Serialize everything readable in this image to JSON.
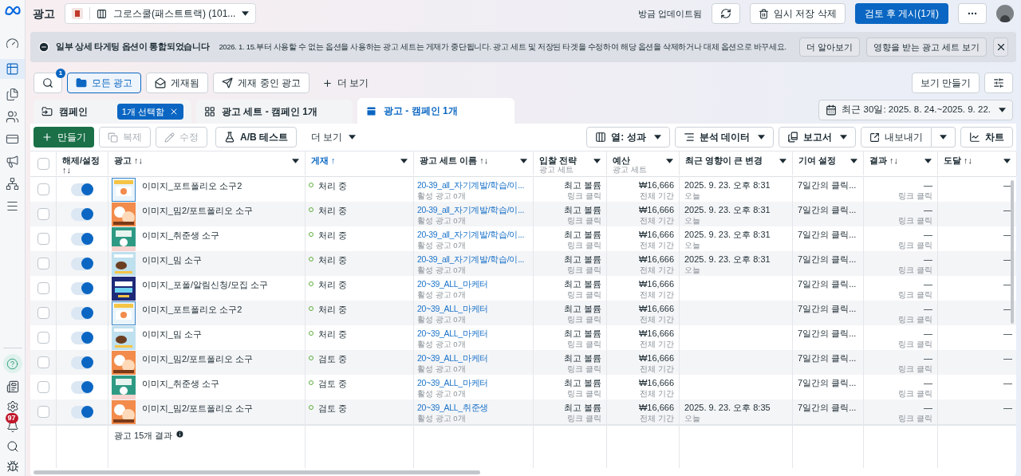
{
  "topbar": {
    "title": "광고",
    "account": "그로스쿨(패스트트랙) (101...",
    "update_status": "방금 업데이트됨",
    "discard": "임시 저장 삭제",
    "publish": "검토 후 게시(1개)"
  },
  "sidebar": {
    "notification_count": "97"
  },
  "banner": {
    "title": "일부 상세 타게팅 옵션이 통합되었습니다",
    "message": "2026. 1. 15.부터 사용할 수 없는 옵션을 사용하는 광고 세트는 게재가 중단됩니다. 광고 세트 및 저장된 타겟을 수정하여 해당 옵션을 삭제하거나 대체 옵션으로 바꾸세요.",
    "buttons": [
      "더 알아보기",
      "영향을 받는 광고 세트 보기"
    ]
  },
  "filters": {
    "search_badge": "1",
    "chips": [
      {
        "label": "모든 광고",
        "selected": true
      },
      {
        "label": "게재됨",
        "selected": false
      },
      {
        "label": "게재 중인 광고",
        "selected": false
      }
    ],
    "more": "더 보기",
    "create_view": "보기 만들기"
  },
  "level_tabs": [
    {
      "label": "캠페인",
      "selected": false,
      "chip": "1개 선택함"
    },
    {
      "label": "광고 세트 - 캠페인 1개",
      "selected": false
    },
    {
      "label": "광고 - 캠페인 1개",
      "selected": true
    }
  ],
  "date_range": "최근 30일: 2025. 8. 24.~2025. 9. 22.",
  "toolbar": {
    "left": [
      {
        "label": "만들기",
        "kind": "primary",
        "disabled": false
      },
      {
        "label": "복제",
        "kind": "duplicate",
        "disabled": true
      },
      {
        "label": "수정",
        "kind": "edit",
        "disabled": true
      },
      {
        "label": "A/B 테스트",
        "kind": "test",
        "disabled": false
      },
      {
        "label": "더 보기",
        "kind": "more",
        "disabled": false
      }
    ],
    "right": [
      {
        "label": "열: 성과",
        "kind": "columns"
      },
      {
        "label": "분석 데이터",
        "kind": "breakdown"
      },
      {
        "label": "보고서",
        "kind": "reports"
      },
      {
        "label": "내보내기",
        "kind": "export"
      },
      {
        "label": "차트",
        "kind": "chart"
      }
    ]
  },
  "table": {
    "all_selected": false,
    "columns": [
      {
        "label": "해제/설정 ↑↓",
        "sorted": false
      },
      {
        "label": "광고 ↑↓",
        "sorted": false
      },
      {
        "label": "게재 ↑",
        "sorted": true
      },
      {
        "label": "광고 세트 이름 ↑↓",
        "sorted": false
      },
      {
        "label": "입찰 전략",
        "sublabel": "광고 세트",
        "sorted": false
      },
      {
        "label": "예산",
        "sublabel": "광고 세트",
        "sorted": false
      },
      {
        "label": "최근 영향이 큰 변경",
        "sorted": false
      },
      {
        "label": "기여 설정",
        "sorted": false
      },
      {
        "label": "결과 ↑↓",
        "sorted": false
      },
      {
        "label": "도달 ↑↓",
        "sorted": false
      }
    ],
    "rows": [
      {
        "selected": false,
        "on": true,
        "name": "이미지_포트폴리오 소구2",
        "status": "처리 중",
        "adset": "20-39_all_자기계발/학습/이...",
        "adset_sub": "활성 광고 0개",
        "bid": "최고 볼륨",
        "bid_sub": "링크 클릭",
        "budget": "₩16,666",
        "budget_sub": "전체 기간",
        "change": "2025. 9. 23. 오후 8:31",
        "change_sub": "오늘",
        "attribution": "7일간의 클릭...",
        "result": "—",
        "result_sub": "링크 클릭",
        "reach": "—"
      },
      {
        "selected": false,
        "on": true,
        "name": "이미지_밈2/포트폴리오 소구",
        "status": "처리 중",
        "adset": "20-39_all_자기계발/학습/이...",
        "adset_sub": "활성 광고 0개",
        "bid": "최고 볼륨",
        "bid_sub": "링크 클릭",
        "budget": "₩16,666",
        "budget_sub": "전체 기간",
        "change": "2025. 9. 23. 오후 8:31",
        "change_sub": "오늘",
        "attribution": "7일간의 클릭...",
        "result": "—",
        "result_sub": "링크 클릭",
        "reach": "—"
      },
      {
        "selected": false,
        "on": true,
        "name": "이미지_취준생 소구",
        "status": "처리 중",
        "adset": "20-39_all_자기계발/학습/이...",
        "adset_sub": "활성 광고 0개",
        "bid": "최고 볼륨",
        "bid_sub": "링크 클릭",
        "budget": "₩16,666",
        "budget_sub": "전체 기간",
        "change": "2025. 9. 23. 오후 8:31",
        "change_sub": "오늘",
        "attribution": "7일간의 클릭...",
        "result": "—",
        "result_sub": "링크 클릭",
        "reach": "—"
      },
      {
        "selected": false,
        "on": true,
        "name": "이미지_밈 소구",
        "status": "처리 중",
        "adset": "20-39_all_자기계발/학습/이...",
        "adset_sub": "활성 광고 0개",
        "bid": "최고 볼륨",
        "bid_sub": "링크 클릭",
        "budget": "₩16,666",
        "budget_sub": "전체 기간",
        "change": "2025. 9. 23. 오후 8:31",
        "change_sub": "오늘",
        "attribution": "7일간의 클릭...",
        "result": "—",
        "result_sub": "링크 클릭",
        "reach": "—"
      },
      {
        "selected": false,
        "on": true,
        "name": "이미지_포폴/알림신청/모집 소구",
        "status": "처리 중",
        "adset": "20~39_ALL_마케터",
        "adset_sub": "활성 광고 0개",
        "bid": "최고 볼륨",
        "bid_sub": "링크 클릭",
        "budget": "₩16,666",
        "budget_sub": "전체 기간",
        "attribution": "7일간의 클릭...",
        "result": "—",
        "result_sub": "링크 클릭",
        "reach": "—"
      },
      {
        "selected": false,
        "on": true,
        "name": "이미지_포트폴리오 소구2",
        "status": "처리 중",
        "adset": "20~39_ALL_마케터",
        "adset_sub": "활성 광고 0개",
        "bid": "최고 볼륨",
        "bid_sub": "링크 클릭",
        "budget": "₩16,666",
        "budget_sub": "전체 기간",
        "attribution": "7일간의 클릭...",
        "result": "—",
        "result_sub": "링크 클릭",
        "reach": "—"
      },
      {
        "selected": false,
        "on": true,
        "name": "이미지_밈 소구",
        "status": "처리 중",
        "adset": "20~39_ALL_마케터",
        "adset_sub": "활성 광고 0개",
        "bid": "최고 볼륨",
        "bid_sub": "링크 클릭",
        "budget": "₩16,666",
        "budget_sub": "전체 기간",
        "attribution": "7일간의 클릭...",
        "result": "—",
        "result_sub": "링크 클릭",
        "reach": "—"
      },
      {
        "selected": false,
        "on": true,
        "name": "이미지_밈2/포트폴리오 소구",
        "status": "검토 중",
        "adset": "20~39_ALL_마케터",
        "adset_sub": "활성 광고 0개",
        "bid": "최고 볼륨",
        "bid_sub": "링크 클릭",
        "budget": "₩16,666",
        "budget_sub": "전체 기간",
        "attribution": "7일간의 클릭...",
        "result": "—",
        "result_sub": "링크 클릭",
        "reach": "—"
      },
      {
        "selected": false,
        "on": true,
        "name": "이미지_취준생 소구",
        "status": "검토 중",
        "adset": "20~39_ALL_마케터",
        "adset_sub": "활성 광고 0개",
        "bid": "최고 볼륨",
        "bid_sub": "링크 클릭",
        "budget": "₩16,666",
        "budget_sub": "전체 기간",
        "attribution": "7일간의 클릭...",
        "result": "—",
        "result_sub": "링크 클릭",
        "reach": "—"
      },
      {
        "selected": false,
        "on": true,
        "name": "이미지_밈2/포트폴리오 소구",
        "status": "검토 중",
        "adset": "20~39_ALL_취준생",
        "adset_sub": "활성 광고 0개",
        "bid": "최고 볼륨",
        "bid_sub": "링크 클릭",
        "budget": "₩16,666",
        "budget_sub": "전체 기간",
        "change": "2025. 9. 23. 오후 8:35",
        "change_sub": "오늘",
        "attribution": "7일간의 클릭...",
        "result": "—",
        "result_sub": "링크 클릭",
        "reach": "—"
      }
    ],
    "footer": "광고 15개 결과"
  }
}
